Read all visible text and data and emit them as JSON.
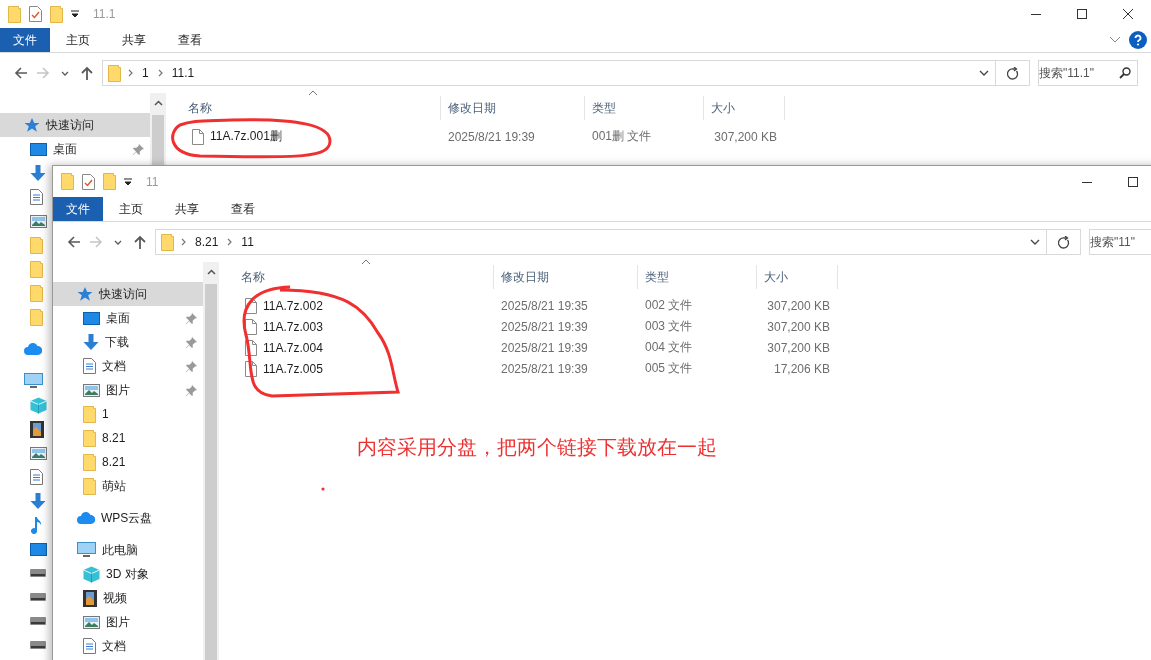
{
  "windows": [
    {
      "title": "11.1",
      "window_buttons": [
        {
          "kind": "minimize"
        },
        {
          "kind": "maximize"
        },
        {
          "kind": "close"
        }
      ],
      "ribbon_tabs": [
        {
          "label": "文件",
          "kind": "file"
        },
        {
          "label": "主页",
          "kind": "tab"
        },
        {
          "label": "共享",
          "kind": "tab"
        },
        {
          "label": "查看",
          "kind": "tab"
        }
      ],
      "ribbon_icons": [
        {
          "kind": "expand"
        },
        {
          "kind": "help"
        }
      ],
      "nav_buttons": [
        {
          "kind": "back",
          "disabled": false
        },
        {
          "kind": "forward",
          "disabled": true
        },
        {
          "kind": "recent",
          "disabled": false
        },
        {
          "kind": "up",
          "disabled": false
        }
      ],
      "address": [
        "1",
        "11.1"
      ],
      "search": {
        "placeholder": "搜索\"11.1\"",
        "icon": true
      },
      "sidebar": [
        {
          "kind": "star",
          "label": "快速访问",
          "selected": true,
          "children": [
            {
              "kind": "desktop",
              "label": "桌面",
              "pinned": true,
              "selected": false
            },
            {
              "kind": "download",
              "pinned": false,
              "selected": false
            },
            {
              "kind": "doc",
              "pinned": false,
              "selected": false
            },
            {
              "kind": "picture",
              "pinned": false,
              "selected": false
            },
            {
              "kind": "folder",
              "pinned": false,
              "selected": false
            },
            {
              "kind": "folder",
              "pinned": false,
              "selected": false
            },
            {
              "kind": "folder",
              "pinned": false,
              "selected": false
            },
            {
              "kind": "folder",
              "pinned": false,
              "selected": false
            }
          ]
        },
        {
          "kind": "cloud",
          "selected": false
        },
        {
          "kind": "pc",
          "selected": false,
          "children": [
            {
              "kind": "cube",
              "pinned": false,
              "selected": false
            },
            {
              "kind": "video",
              "pinned": false,
              "selected": false
            },
            {
              "kind": "picture",
              "pinned": false,
              "selected": false
            },
            {
              "kind": "doc",
              "pinned": false,
              "selected": false
            },
            {
              "kind": "download",
              "pinned": false,
              "selected": false
            },
            {
              "kind": "music",
              "pinned": false,
              "selected": false
            },
            {
              "kind": "desktop",
              "pinned": false,
              "selected": false
            },
            {
              "kind": "drive",
              "pinned": false,
              "selected": false
            },
            {
              "kind": "drive",
              "pinned": false,
              "selected": false
            },
            {
              "kind": "drive",
              "pinned": false,
              "selected": false
            },
            {
              "kind": "drive",
              "pinned": false,
              "selected": false
            }
          ]
        }
      ],
      "columns": [
        "名称",
        "修改日期",
        "类型",
        "大小"
      ],
      "files": [
        {
          "name": "11A.7z.001删",
          "modified": "2025/8/21 19:39",
          "type": "001删 文件",
          "size": "307,200 KB"
        }
      ]
    },
    {
      "title": "11",
      "window_buttons": [
        {
          "kind": "minimize"
        },
        {
          "kind": "maximize"
        }
      ],
      "ribbon_tabs": [
        {
          "label": "文件",
          "kind": "file"
        },
        {
          "label": "主页",
          "kind": "tab"
        },
        {
          "label": "共享",
          "kind": "tab"
        },
        {
          "label": "查看",
          "kind": "tab"
        }
      ],
      "nav_buttons": [
        {
          "kind": "back",
          "disabled": false
        },
        {
          "kind": "forward",
          "disabled": true
        },
        {
          "kind": "recent",
          "disabled": false
        },
        {
          "kind": "up",
          "disabled": false
        }
      ],
      "address": [
        "8.21",
        "11"
      ],
      "search": {
        "placeholder": "搜索\"11\""
      },
      "sidebar": [
        {
          "kind": "star",
          "label": "快速访问",
          "selected": true,
          "children": [
            {
              "kind": "desktop",
              "label": "桌面",
              "pinned": true,
              "selected": false
            },
            {
              "kind": "download",
              "label": "下载",
              "pinned": true,
              "selected": false
            },
            {
              "kind": "doc",
              "label": "文档",
              "pinned": true,
              "selected": false
            },
            {
              "kind": "picture",
              "label": "图片",
              "pinned": true,
              "selected": false
            },
            {
              "kind": "folder",
              "label": "1",
              "pinned": false,
              "selected": false
            },
            {
              "kind": "folder",
              "label": "8.21",
              "pinned": false,
              "selected": false
            },
            {
              "kind": "folder",
              "label": "8.21",
              "pinned": false,
              "selected": false
            },
            {
              "kind": "folder",
              "label": "萌站",
              "pinned": false,
              "selected": false
            }
          ]
        },
        {
          "kind": "cloud",
          "label": "WPS云盘",
          "selected": false
        },
        {
          "kind": "pc",
          "label": "此电脑",
          "selected": false,
          "children": [
            {
              "kind": "cube",
              "label": "3D 对象",
              "pinned": false,
              "selected": false
            },
            {
              "kind": "video",
              "label": "视频",
              "pinned": false,
              "selected": false
            },
            {
              "kind": "picture",
              "label": "图片",
              "pinned": false,
              "selected": false
            },
            {
              "kind": "doc",
              "label": "文档",
              "pinned": false,
              "selected": false
            }
          ]
        }
      ],
      "columns": [
        "名称",
        "修改日期",
        "类型",
        "大小"
      ],
      "files": [
        {
          "name": "11A.7z.002",
          "modified": "2025/8/21 19:35",
          "type": "002 文件",
          "size": "307,200 KB"
        },
        {
          "name": "11A.7z.003",
          "modified": "2025/8/21 19:39",
          "type": "003 文件",
          "size": "307,200 KB"
        },
        {
          "name": "11A.7z.004",
          "modified": "2025/8/21 19:39",
          "type": "004 文件",
          "size": "307,200 KB"
        },
        {
          "name": "11A.7z.005",
          "modified": "2025/8/21 19:39",
          "type": "005 文件",
          "size": "17,206 KB"
        }
      ]
    }
  ],
  "annotations": {
    "note": "内容采用分盘，把两个链接下载放在一起"
  }
}
